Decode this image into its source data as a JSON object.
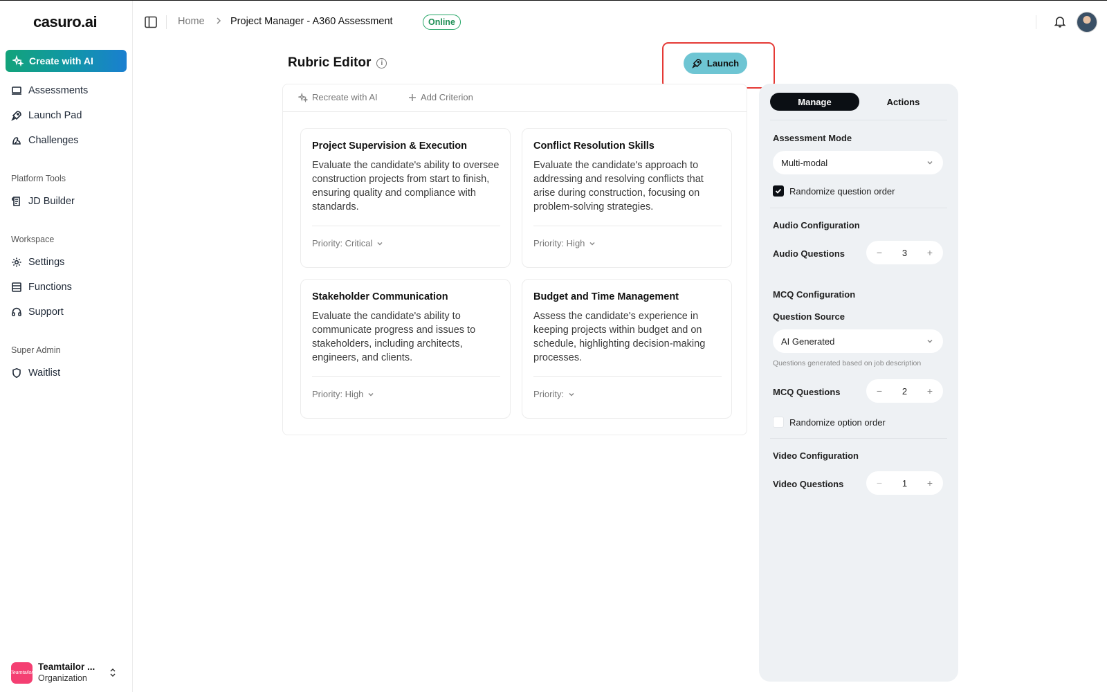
{
  "app": {
    "logo": "casuro.ai"
  },
  "sidebar": {
    "create_label": "Create with AI",
    "main_items": [
      {
        "label": "Assessments",
        "icon": "laptop-icon"
      },
      {
        "label": "Launch Pad",
        "icon": "rocket-icon"
      },
      {
        "label": "Challenges",
        "icon": "puzzle-icon"
      }
    ],
    "platform_tools_label": "Platform Tools",
    "platform_items": [
      {
        "label": "JD Builder",
        "icon": "scroll-icon"
      }
    ],
    "workspace_label": "Workspace",
    "workspace_items": [
      {
        "label": "Settings",
        "icon": "gear-icon"
      },
      {
        "label": "Functions",
        "icon": "table-icon"
      },
      {
        "label": "Support",
        "icon": "headset-icon"
      }
    ],
    "super_admin_label": "Super Admin",
    "admin_items": [
      {
        "label": "Waitlist",
        "icon": "shield-icon"
      }
    ],
    "org": {
      "name": "Teamtailor ...",
      "subtitle": "Organization",
      "logo_text": "Teamtailor"
    }
  },
  "header": {
    "breadcrumb_home": "Home",
    "breadcrumb_title": "Project Manager - A360 Assessment",
    "status_badge": "Online"
  },
  "editor": {
    "title": "Rubric Editor",
    "launch_label": "Launch",
    "recreate_label": "Recreate with AI",
    "add_criterion_label": "Add Criterion",
    "criteria": [
      {
        "title": "Project Supervision & Execution",
        "description": "Evaluate the candidate's ability to oversee construction projects from start to finish, ensuring quality and compliance with standards.",
        "priority": "Priority: Critical"
      },
      {
        "title": "Conflict Resolution Skills",
        "description": "Evaluate the candidate's approach to addressing and resolving conflicts that arise during construction, focusing on problem-solving strategies.",
        "priority": "Priority: High"
      },
      {
        "title": "Stakeholder Communication",
        "description": "Evaluate the candidate's ability to communicate progress and issues to stakeholders, including architects, engineers, and clients.",
        "priority": "Priority: High"
      },
      {
        "title": "Budget and Time Management",
        "description": "Assess the candidate's experience in keeping projects within budget and on schedule, highlighting decision-making processes.",
        "priority": "Priority:"
      }
    ]
  },
  "panel": {
    "tab_manage": "Manage",
    "tab_actions": "Actions",
    "assessment_mode_label": "Assessment Mode",
    "assessment_mode_value": "Multi-modal",
    "randomize_questions_label": "Randomize question order",
    "randomize_questions_checked": true,
    "audio_config_label": "Audio Configuration",
    "audio_questions_label": "Audio Questions",
    "audio_questions_value": "3",
    "mcq_config_label": "MCQ Configuration",
    "question_source_label": "Question Source",
    "question_source_value": "AI Generated",
    "question_source_hint": "Questions generated based on job description",
    "mcq_questions_label": "MCQ Questions",
    "mcq_questions_value": "2",
    "randomize_options_label": "Randomize option order",
    "randomize_options_checked": false,
    "video_config_label": "Video Configuration",
    "video_questions_label": "Video Questions",
    "video_questions_value": "1",
    "minus_symbol": "−",
    "plus_symbol": "+"
  },
  "colors": {
    "accent_gradient_start": "#12a37a",
    "accent_gradient_end": "#1a7fd0",
    "online_green": "#22a565",
    "launch_bg": "#6ec5d3",
    "highlight_red": "#e53935"
  }
}
